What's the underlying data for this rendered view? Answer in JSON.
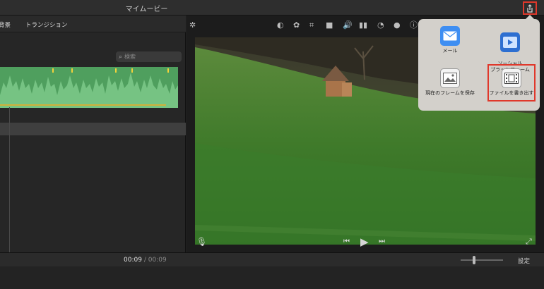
{
  "window": {
    "title": "マイムービー"
  },
  "browser": {
    "tabs": [
      {
        "label": "背景"
      },
      {
        "label": "トランジション"
      }
    ],
    "search_placeholder": "検索"
  },
  "viewer": {
    "tools": [
      "magic-wand-icon",
      "color-balance-icon",
      "color-correction-icon",
      "crop-icon",
      "stabilization-icon",
      "volume-icon",
      "equalizer-icon",
      "speed-icon",
      "clip-filter-icon",
      "info-icon"
    ]
  },
  "playback": {
    "current_time": "00:09",
    "separator": "/",
    "total_time": "00:09",
    "settings_label": "設定"
  },
  "share_menu": {
    "items": [
      {
        "label": "メール",
        "icon": "mail-icon"
      },
      {
        "label": "ソーシャル\nプラットフォーム",
        "icon": "social-platform-icon"
      },
      {
        "label": "現在のフレームを保存",
        "icon": "save-frame-icon"
      },
      {
        "label": "ファイルを書き出す",
        "icon": "export-file-icon"
      }
    ]
  },
  "colors": {
    "accent_highlight": "#e0382b",
    "clip_green": "#4f9f5e",
    "popover_bg": "#d3d0cb"
  }
}
